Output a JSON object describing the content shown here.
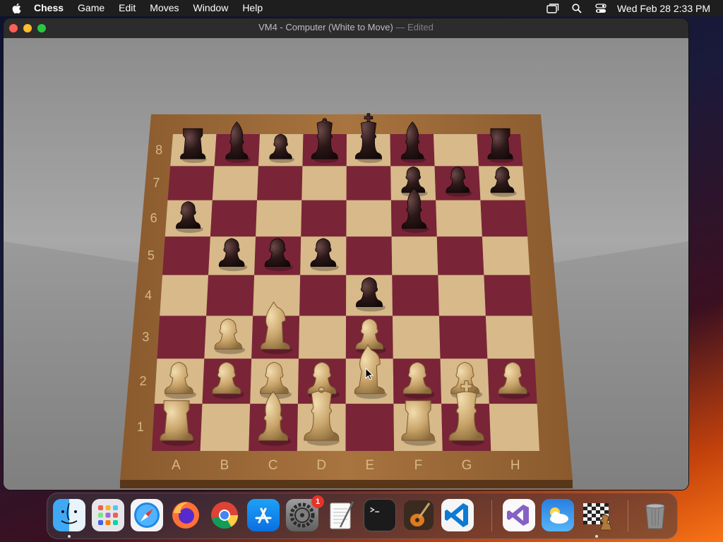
{
  "menubar": {
    "apple_icon": "apple-logo-icon",
    "app_name": "Chess",
    "menus": [
      "Game",
      "Edit",
      "Moves",
      "Window",
      "Help"
    ],
    "status_icons": [
      "window-switcher-icon",
      "search-icon",
      "control-center-icon"
    ],
    "clock": "Wed Feb 28  2:33 PM"
  },
  "window": {
    "title": "VM4 - Computer   (White to Move)",
    "title_separator": "—",
    "edited_label": "Edited"
  },
  "board": {
    "ranks": [
      "8",
      "7",
      "6",
      "5",
      "4",
      "3",
      "2",
      "1"
    ],
    "files": [
      "A",
      "B",
      "C",
      "D",
      "E",
      "F",
      "G",
      "H"
    ],
    "position": {
      "a8": "bR",
      "b8": "bB",
      "c8": "bP",
      "d8": "bQ",
      "e8": "bK",
      "f8": "bB",
      "h8": "bR",
      "f7": "bP",
      "g7": "bP",
      "h7": "bP",
      "a6": "bP",
      "f6": "bB",
      "b5": "bP",
      "c5": "bP",
      "d5": "bP",
      "e4": "bP",
      "b3": "wP",
      "c3": "wN",
      "e3": "wP",
      "a2": "wP",
      "b2": "wP",
      "c2": "wP",
      "d2": "wP",
      "e2": "wN",
      "f2": "wP",
      "g2": "wP",
      "h2": "wP",
      "a1": "wR",
      "c1": "wB",
      "d1": "wQ",
      "f1": "wR",
      "g1": "wK"
    },
    "colors": {
      "light_square": "#d7b98a",
      "dark_square": "#7a2438",
      "frame": "#9c6a3a",
      "black_piece": "#2a1616",
      "white_piece": "#c9a46a"
    }
  },
  "dock": {
    "apps": [
      {
        "name": "Finder",
        "icon": "finder-icon",
        "running": true
      },
      {
        "name": "Launchpad",
        "icon": "launchpad-icon",
        "running": false
      },
      {
        "name": "Safari",
        "icon": "safari-icon",
        "running": false
      },
      {
        "name": "Firefox",
        "icon": "firefox-icon",
        "running": false
      },
      {
        "name": "Chrome",
        "icon": "chrome-icon",
        "running": false
      },
      {
        "name": "App Store",
        "icon": "app-store-icon",
        "running": false
      },
      {
        "name": "System Settings",
        "icon": "system-settings-icon",
        "running": false,
        "badge": "1"
      },
      {
        "name": "TextEdit",
        "icon": "textedit-icon",
        "running": false
      },
      {
        "name": "Terminal",
        "icon": "terminal-icon",
        "running": false
      },
      {
        "name": "GarageBand",
        "icon": "garageband-icon",
        "running": false
      },
      {
        "name": "Visual Studio Code",
        "icon": "vscode-icon",
        "running": false
      },
      {
        "name": "Visual Studio",
        "icon": "visual-studio-icon",
        "running": false
      },
      {
        "name": "Weather",
        "icon": "weather-icon",
        "running": false
      },
      {
        "name": "Chess",
        "icon": "chess-icon",
        "running": true
      },
      {
        "name": "Trash",
        "icon": "trash-icon",
        "running": false
      }
    ]
  }
}
